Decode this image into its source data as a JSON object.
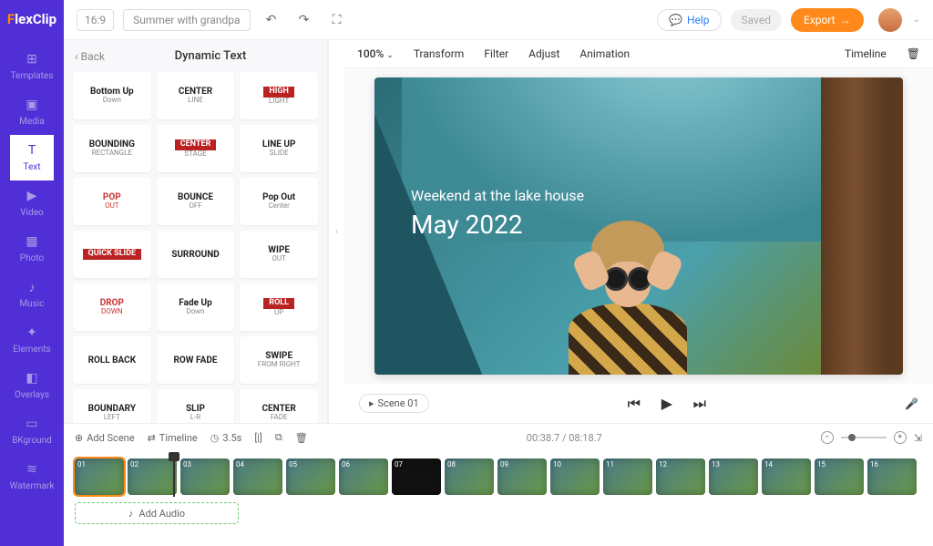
{
  "brand": {
    "pre": "F",
    "rest": "lexClip"
  },
  "topbar": {
    "ratio": "16:9",
    "project_name": "Summer with grandpa",
    "help": "Help",
    "saved": "Saved",
    "export": "Export"
  },
  "sidebar": {
    "items": [
      {
        "label": "Templates",
        "icon": "⊞"
      },
      {
        "label": "Media",
        "icon": "▣"
      },
      {
        "label": "Text",
        "icon": "T"
      },
      {
        "label": "Video",
        "icon": "▶"
      },
      {
        "label": "Photo",
        "icon": "▦"
      },
      {
        "label": "Music",
        "icon": "♪"
      },
      {
        "label": "Elements",
        "icon": "✦"
      },
      {
        "label": "Overlays",
        "icon": "◧"
      },
      {
        "label": "BKground",
        "icon": "▭"
      },
      {
        "label": "Watermark",
        "icon": "≋"
      }
    ]
  },
  "panel": {
    "back": "Back",
    "title": "Dynamic Text",
    "cards": [
      {
        "l1": "Bottom Up",
        "l2": "Down"
      },
      {
        "l1": "CENTER",
        "l2": "LINE"
      },
      {
        "l1": "HIGH",
        "l2": "LIGHT",
        "style": "redbox"
      },
      {
        "l1": "BOUNDING",
        "l2": "RECTANGLE"
      },
      {
        "l1": "CENTER",
        "l2": "STAGE",
        "style": "redbox"
      },
      {
        "l1": "LINE UP",
        "l2": "SLIDE"
      },
      {
        "l1": "POP",
        "l2": "OUT",
        "style": "red"
      },
      {
        "l1": "BOUNCE",
        "l2": "OFF"
      },
      {
        "l1": "Pop Out",
        "l2": "Center"
      },
      {
        "l1": "QUICK SLIDE",
        "l2": "",
        "style": "redbox"
      },
      {
        "l1": "SURROUND",
        "l2": ""
      },
      {
        "l1": "WIPE",
        "l2": "OUT"
      },
      {
        "l1": "DROP",
        "l2": "DOWN",
        "style": "red"
      },
      {
        "l1": "Fade Up",
        "l2": "Down"
      },
      {
        "l1": "ROLL",
        "l2": "UP",
        "style": "redbox"
      },
      {
        "l1": "ROLL BACK",
        "l2": ""
      },
      {
        "l1": "ROW FADE",
        "l2": ""
      },
      {
        "l1": "SWIPE",
        "l2": "FROM RIGHT"
      },
      {
        "l1": "BOUNDARY",
        "l2": "LEFT"
      },
      {
        "l1": "SLIP",
        "l2": "L-R"
      },
      {
        "l1": "CENTER",
        "l2": "FADE"
      }
    ]
  },
  "stage_toolbar": {
    "zoom": "100%",
    "transform": "Transform",
    "filter": "Filter",
    "adjust": "Adjust",
    "animation": "Animation",
    "timeline": "Timeline"
  },
  "overlay": {
    "line1": "Weekend at the lake house",
    "line2": "May 2022"
  },
  "playbar": {
    "scene": "Scene 01"
  },
  "timeline": {
    "add_scene": "Add Scene",
    "timeline": "Timeline",
    "duration": "3.5s",
    "time": "00:38.7 / 08:18.7",
    "add_audio": "Add Audio",
    "clips": [
      "01",
      "02",
      "03",
      "04",
      "05",
      "06",
      "07",
      "08",
      "09",
      "10",
      "11",
      "12",
      "13",
      "14",
      "15",
      "16"
    ]
  }
}
